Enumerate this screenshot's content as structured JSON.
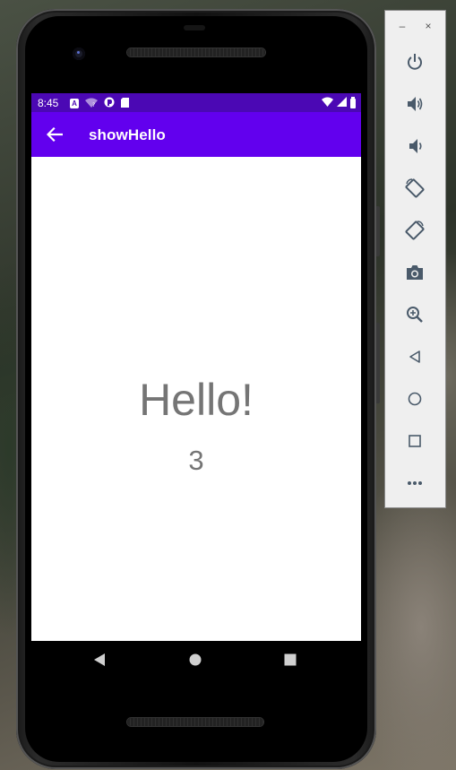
{
  "status_bar": {
    "time": "8:45",
    "icons": [
      "a-notification-icon",
      "wifi-question-icon",
      "circle-notification-icon",
      "sd-card-icon",
      "wifi-icon",
      "signal-icon",
      "battery-icon"
    ],
    "small_letter": "A"
  },
  "app_bar": {
    "title": "showHello",
    "back_icon": "arrow-back-icon"
  },
  "content": {
    "hello_text": "Hello!",
    "count_text": "3"
  },
  "nav_bar": {
    "buttons": [
      "back-triangle-icon",
      "home-circle-icon",
      "recents-square-icon"
    ]
  },
  "emulator_toolbar": {
    "minimize_label": "–",
    "close_label": "×",
    "buttons": [
      "power-icon",
      "volume-up-icon",
      "volume-down-icon",
      "rotate-left-icon",
      "rotate-right-icon",
      "camera-icon",
      "zoom-icon",
      "back-icon",
      "home-icon",
      "overview-icon",
      "more-icon"
    ]
  },
  "colors": {
    "status_bar": "#4b08b4",
    "app_bar": "#6200ee",
    "text_gray": "#757575",
    "toolbar_icon": "#4a5a6a"
  }
}
